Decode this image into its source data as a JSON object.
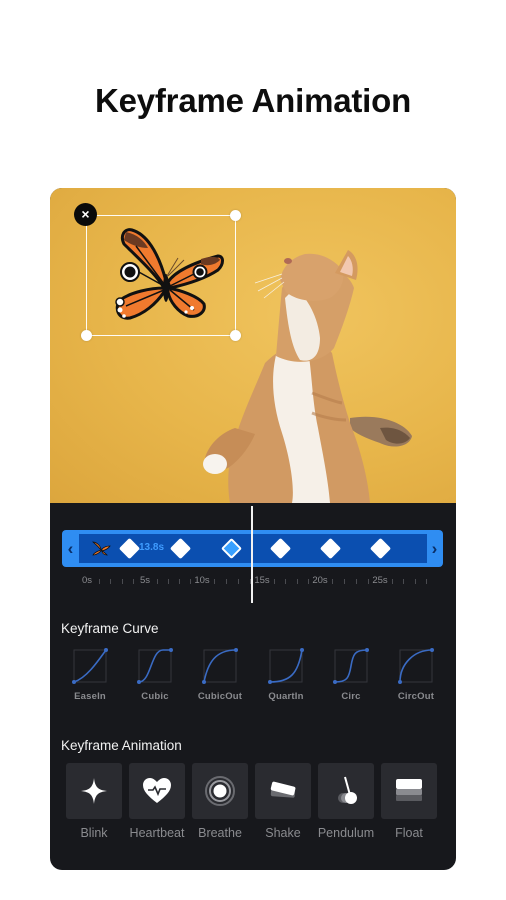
{
  "headline": "Keyframe Animation",
  "editor": {
    "sticker": {
      "name": "butterfly",
      "close_icon": "×"
    },
    "timeline": {
      "left_arrow": "‹",
      "right_arrow": "›",
      "duration_label": "13.8s",
      "keyframe_count": 6,
      "active_keyframe_index": 2,
      "ruler_labels": [
        "0s",
        "5s",
        "10s",
        "15s",
        "20s",
        "25s"
      ]
    },
    "curve_section": {
      "title": "Keyframe Curve",
      "items": [
        {
          "label": "EaseIn",
          "icon": "easein-curve-icon"
        },
        {
          "label": "Cubic",
          "icon": "cubic-curve-icon"
        },
        {
          "label": "CubicOut",
          "icon": "cubicout-curve-icon"
        },
        {
          "label": "QuartIn",
          "icon": "quartin-curve-icon"
        },
        {
          "label": "Circ",
          "icon": "circ-curve-icon"
        },
        {
          "label": "CircOut",
          "icon": "circout-curve-icon"
        }
      ]
    },
    "animation_section": {
      "title": "Keyframe Animation",
      "items": [
        {
          "label": "Blink",
          "icon": "sparkle-icon"
        },
        {
          "label": "Heartbeat",
          "icon": "heartbeat-icon"
        },
        {
          "label": "Breathe",
          "icon": "breathe-rings-icon"
        },
        {
          "label": "Shake",
          "icon": "shake-icon"
        },
        {
          "label": "Pendulum",
          "icon": "pendulum-icon"
        },
        {
          "label": "Float",
          "icon": "float-layers-icon"
        }
      ]
    },
    "colors": {
      "accent": "#2f8df2",
      "track_fill": "#0b4fb0",
      "panel_bg": "#17181c",
      "photo_bg": "#e7b54a",
      "curve_stroke": "#3a6bc4"
    }
  }
}
